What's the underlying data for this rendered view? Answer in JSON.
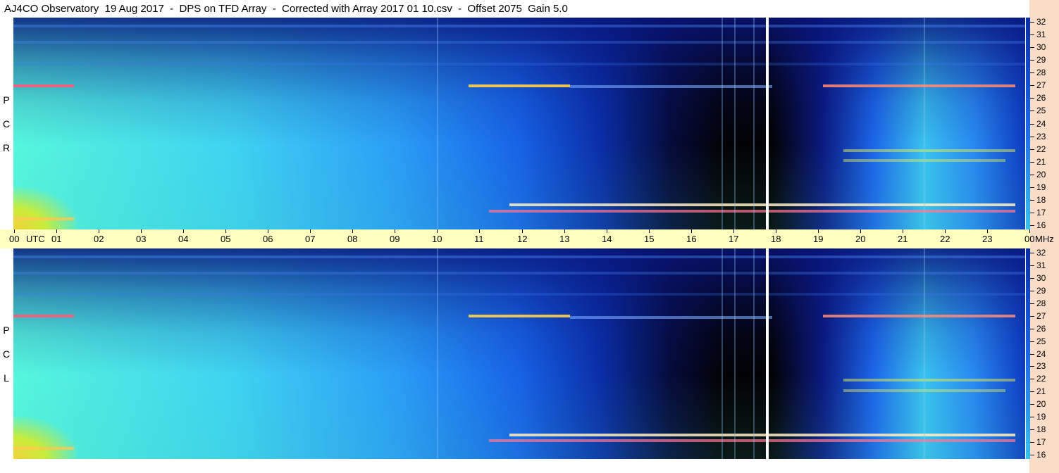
{
  "header": {
    "title": "AJ4CO Observatory  19 Aug 2017  -  DPS on TFD Array  -  Corrected with Array 2017 01 10.csv  -  Offset 2075  Gain 5.0"
  },
  "chart_data": {
    "type": "heatmap",
    "panels": [
      {
        "label_letters": [
          "P",
          "C",
          "R"
        ]
      },
      {
        "label_letters": [
          "P",
          "C",
          "L"
        ]
      }
    ],
    "x_tick_labels": [
      "00",
      "UTC",
      "01",
      "02",
      "03",
      "04",
      "05",
      "06",
      "07",
      "08",
      "09",
      "10",
      "11",
      "12",
      "13",
      "14",
      "15",
      "16",
      "17",
      "18",
      "19",
      "20",
      "21",
      "22",
      "23",
      "00",
      "MHz"
    ],
    "x_hours": [
      0,
      1,
      2,
      3,
      4,
      5,
      6,
      7,
      8,
      9,
      10,
      11,
      12,
      13,
      14,
      15,
      16,
      17,
      18,
      19,
      20,
      21,
      22,
      23,
      24
    ],
    "y_tick_labels": [
      "32",
      "31",
      "30",
      "29",
      "28",
      "27",
      "26",
      "25",
      "24",
      "23",
      "22",
      "21",
      "20",
      "19",
      "18",
      "17",
      "16"
    ],
    "y_range_mhz": [
      16,
      32
    ],
    "x_range_utc_hours": [
      0,
      24
    ],
    "colors": {
      "low": "#020205",
      "mid": "#1763e6",
      "high": "#56f6dc",
      "peak": "#f2d13a",
      "axis_band": "#ffffc0",
      "right_strip": "#fbdcc6"
    }
  }
}
